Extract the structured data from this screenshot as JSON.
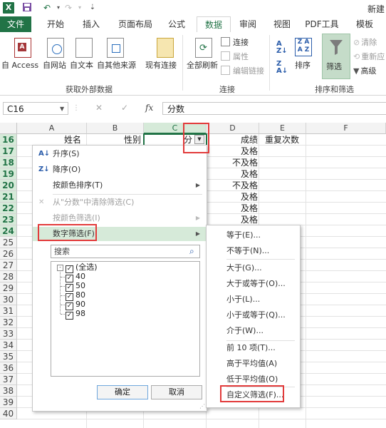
{
  "title_bar": {
    "app_icon": "X",
    "title": "新建"
  },
  "ribbon": {
    "tabs": [
      "文件",
      "开始",
      "插入",
      "页面布局",
      "公式",
      "数据",
      "审阅",
      "视图",
      "PDF工具",
      "模板"
    ],
    "active_tab": "数据",
    "get_external": {
      "buttons": [
        "自 Access",
        "自网站",
        "自文本",
        "自其他来源",
        "现有连接"
      ],
      "group_label": "获取外部数据"
    },
    "connections": {
      "refresh_all": "全部刷新",
      "items": [
        "连接",
        "属性",
        "编辑链接"
      ],
      "group_label": "连接"
    },
    "sort_filter": {
      "sort": "排序",
      "filter": "筛选",
      "small": [
        "清除",
        "重新应",
        "高级"
      ],
      "group_label": "排序和筛选"
    }
  },
  "formula_bar": {
    "name_box": "C16",
    "fx": "fx",
    "cancel": "✕",
    "enter": "✓",
    "value": "分数"
  },
  "columns": [
    "A",
    "B",
    "C",
    "D",
    "E",
    "F"
  ],
  "rows": [
    "16",
    "17",
    "18",
    "19",
    "20",
    "21",
    "22",
    "23",
    "24",
    "25",
    "26",
    "27",
    "28",
    "29",
    "30",
    "31",
    "32",
    "33",
    "34",
    "35",
    "36",
    "37",
    "38",
    "39",
    "40"
  ],
  "cells": {
    "a16": "姓名",
    "b16": "性别",
    "c16": "分",
    "d16": "成绩",
    "e16": "重复次数",
    "d_values": [
      "及格",
      "不及格",
      "及格",
      "不及格",
      "及格",
      "及格",
      "及格"
    ]
  },
  "filter_menu": {
    "items": {
      "sort_asc": "升序(S)",
      "sort_desc": "降序(O)",
      "sort_by_color": "按颜色排序(T)",
      "clear_filter": "从\"分数\"中清除筛选(C)",
      "filter_by_color": "按颜色筛选(I)",
      "number_filter": "数字筛选(F)"
    },
    "search_placeholder": "搜索",
    "list": [
      "(全选)",
      "40",
      "50",
      "80",
      "90",
      "98"
    ],
    "ok": "确定",
    "cancel": "取消"
  },
  "number_submenu": {
    "items": [
      "等于(E)...",
      "不等于(N)...",
      "大于(G)...",
      "大于或等于(O)...",
      "小于(L)...",
      "小于或等于(Q)...",
      "介于(W)...",
      "前 10 项(T)...",
      "高于平均值(A)",
      "低于平均值(O)",
      "自定义筛选(F)..."
    ]
  },
  "colors": {
    "excel_green": "#217346",
    "highlight": "#d6ead9",
    "annotation_red": "#e23b3b"
  }
}
